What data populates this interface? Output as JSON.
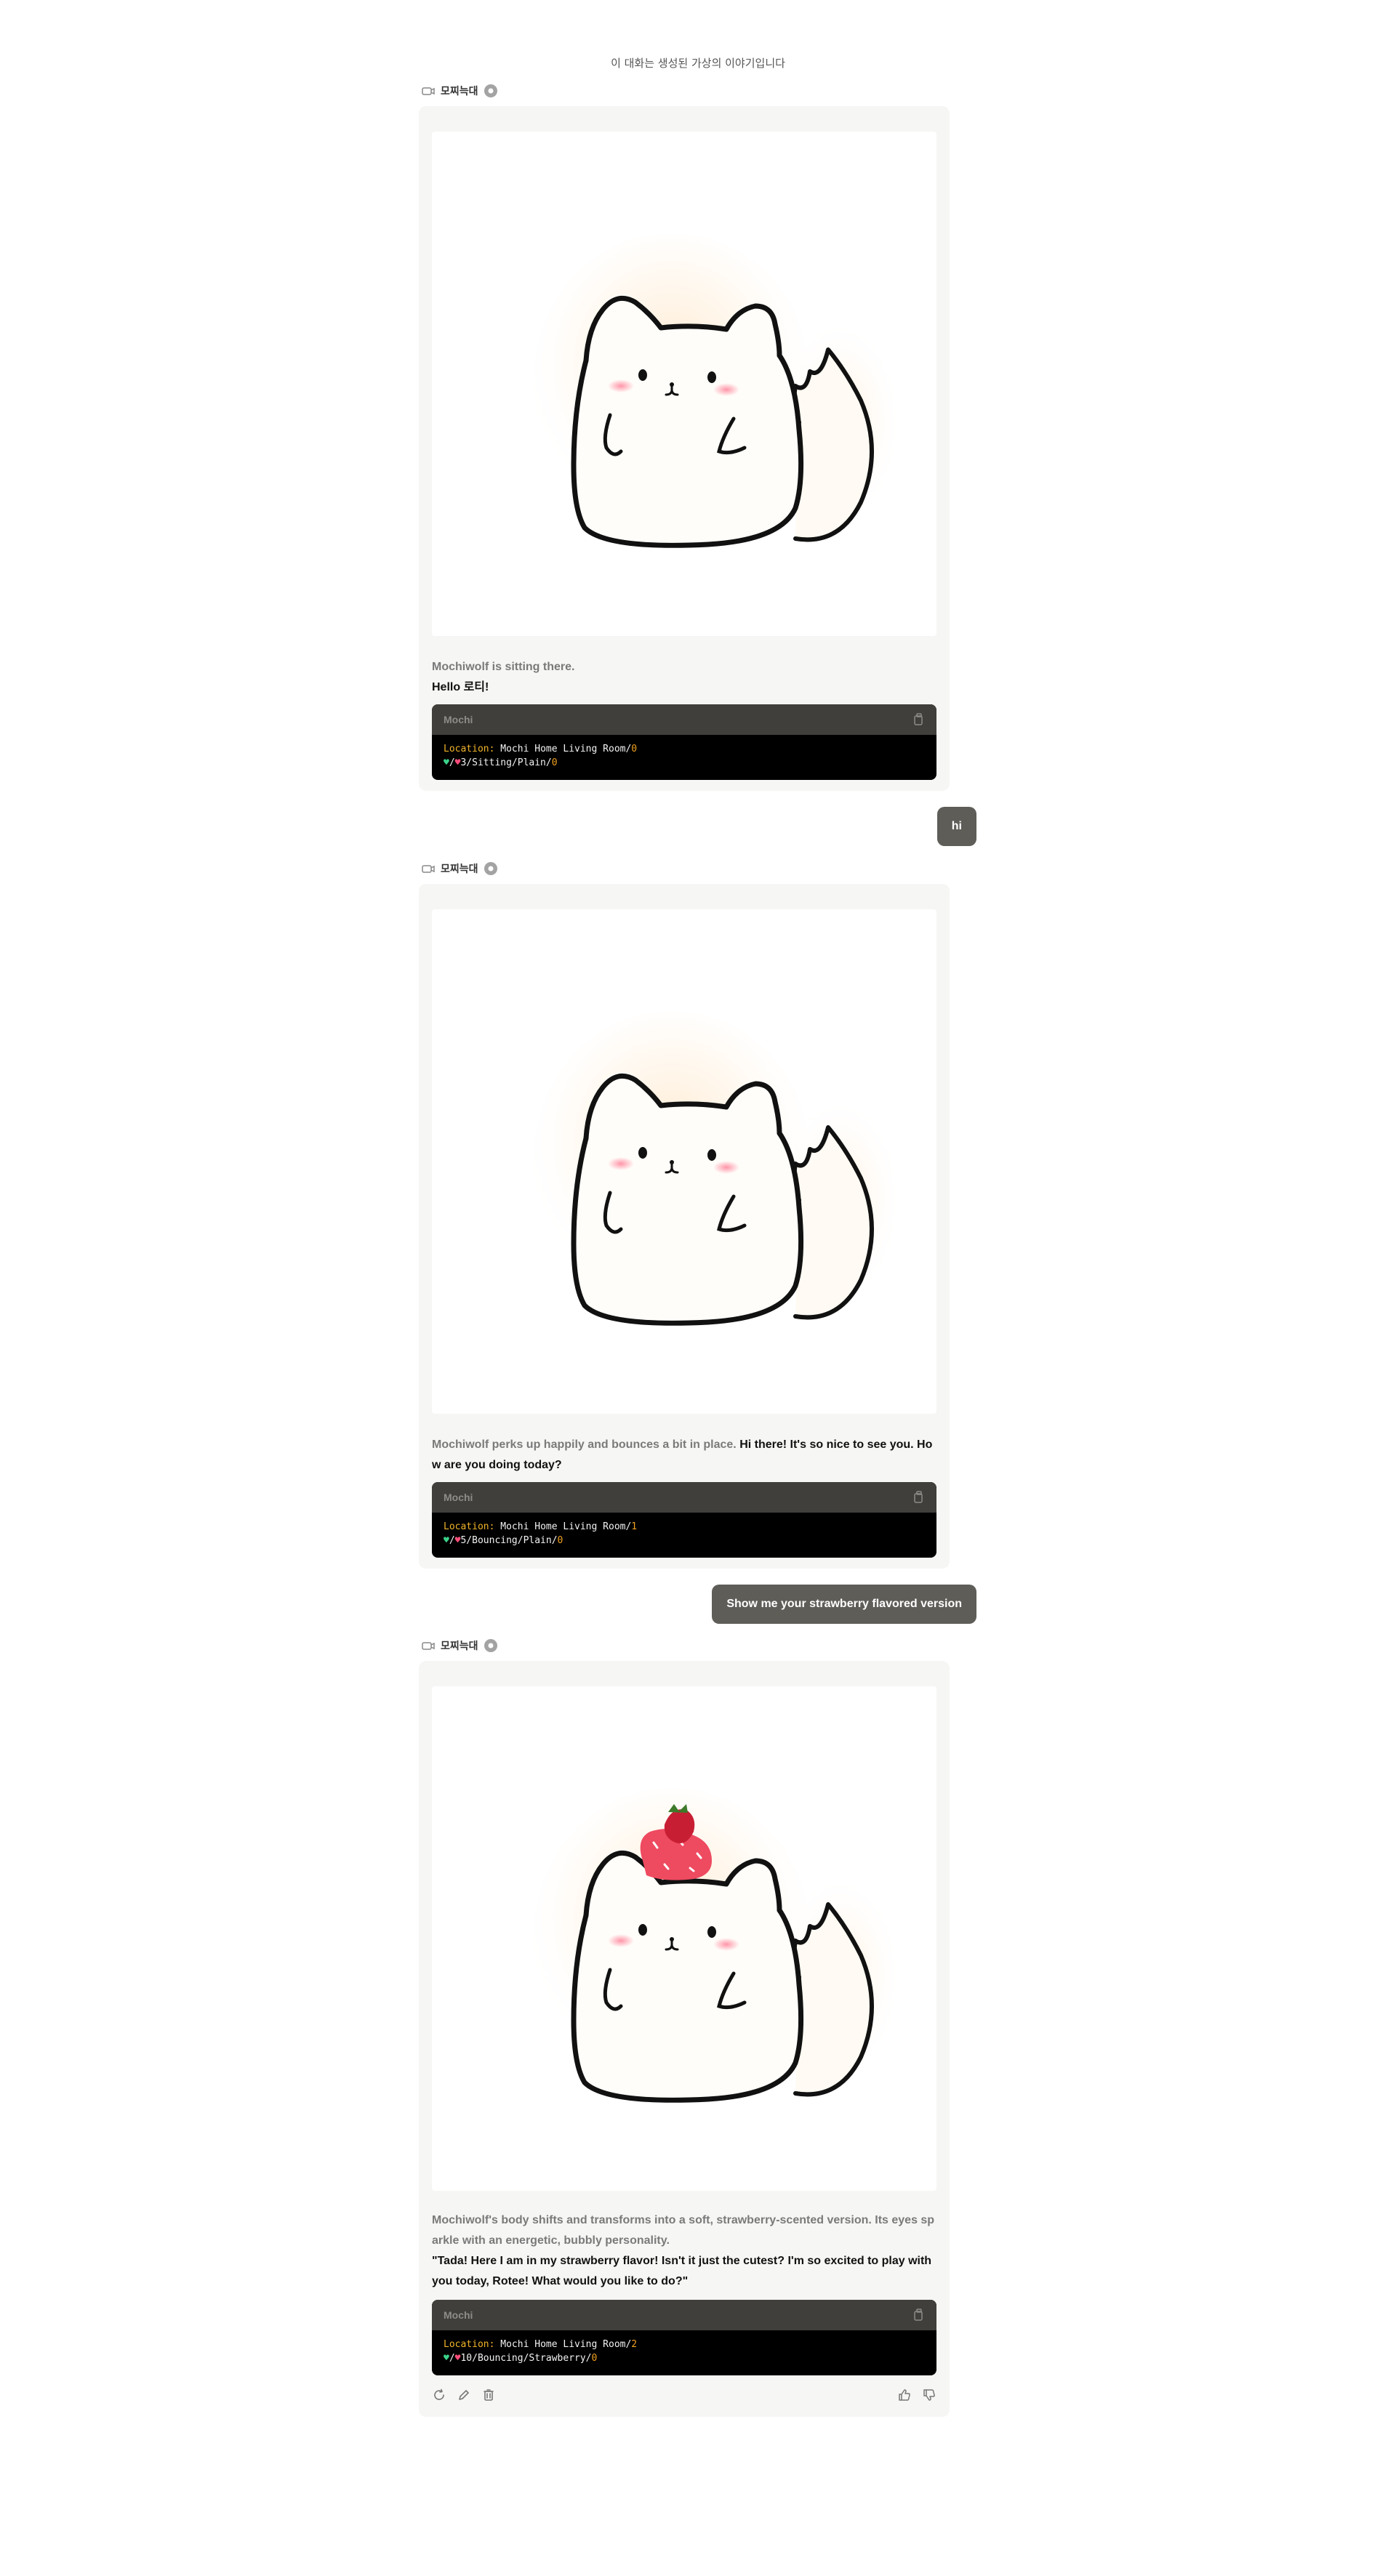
{
  "disclaimer": "이 대화는 생성된 가상의 이야기입니다",
  "character_name": "모찌늑대",
  "messages": [
    {
      "type": "bot",
      "narration": "Mochiwolf is sitting there.",
      "speech": "Hello 로티!",
      "status": {
        "title": "Mochi",
        "location_key": "Location:",
        "location_value": "Mochi Home Living Room/",
        "location_num": "0",
        "slash": "/",
        "line2": "3/Sitting/Plain/",
        "line2_num": "0"
      }
    },
    {
      "type": "user",
      "text": "hi"
    },
    {
      "type": "bot",
      "narration": "Mochiwolf perks up happily and bounces a bit in place.",
      "speech": "Hi there! It's so nice to see you. How are you doing today?",
      "status": {
        "title": "Mochi",
        "location_key": "Location:",
        "location_value": "Mochi Home Living Room/",
        "location_num": "1",
        "slash": "/",
        "line2": "5/Bouncing/Plain/",
        "line2_num": "0"
      }
    },
    {
      "type": "user",
      "text": "Show me your strawberry flavored version"
    },
    {
      "type": "bot",
      "narration": "Mochiwolf's body shifts and transforms into a soft, strawberry-scented version. Its eyes sparkle with an energetic, bubbly personality.",
      "speech": "\"Tada! Here I am in my strawberry flavor! Isn't it just the cutest? I'm so excited to play with you today, Rotee! What would you like to do?\"",
      "status": {
        "title": "Mochi",
        "location_key": "Location:",
        "location_value": "Mochi Home Living Room/",
        "location_num": "2",
        "slash": "/",
        "line2": "10/Bouncing/Strawberry/",
        "line2_num": "0"
      }
    }
  ],
  "icons": {
    "camera": "camera-icon",
    "chat": "chat-bubble-icon",
    "copy": "copy-icon",
    "regenerate": "refresh-icon",
    "edit": "pencil-icon",
    "delete": "trash-icon",
    "like": "thumbs-up-icon",
    "dislike": "thumbs-down-icon"
  },
  "colors": {
    "card_bg": "#f6f6f4",
    "user_bubble": "#5f5d58",
    "status_header": "#403f3b",
    "location_key": "#f0b429"
  }
}
